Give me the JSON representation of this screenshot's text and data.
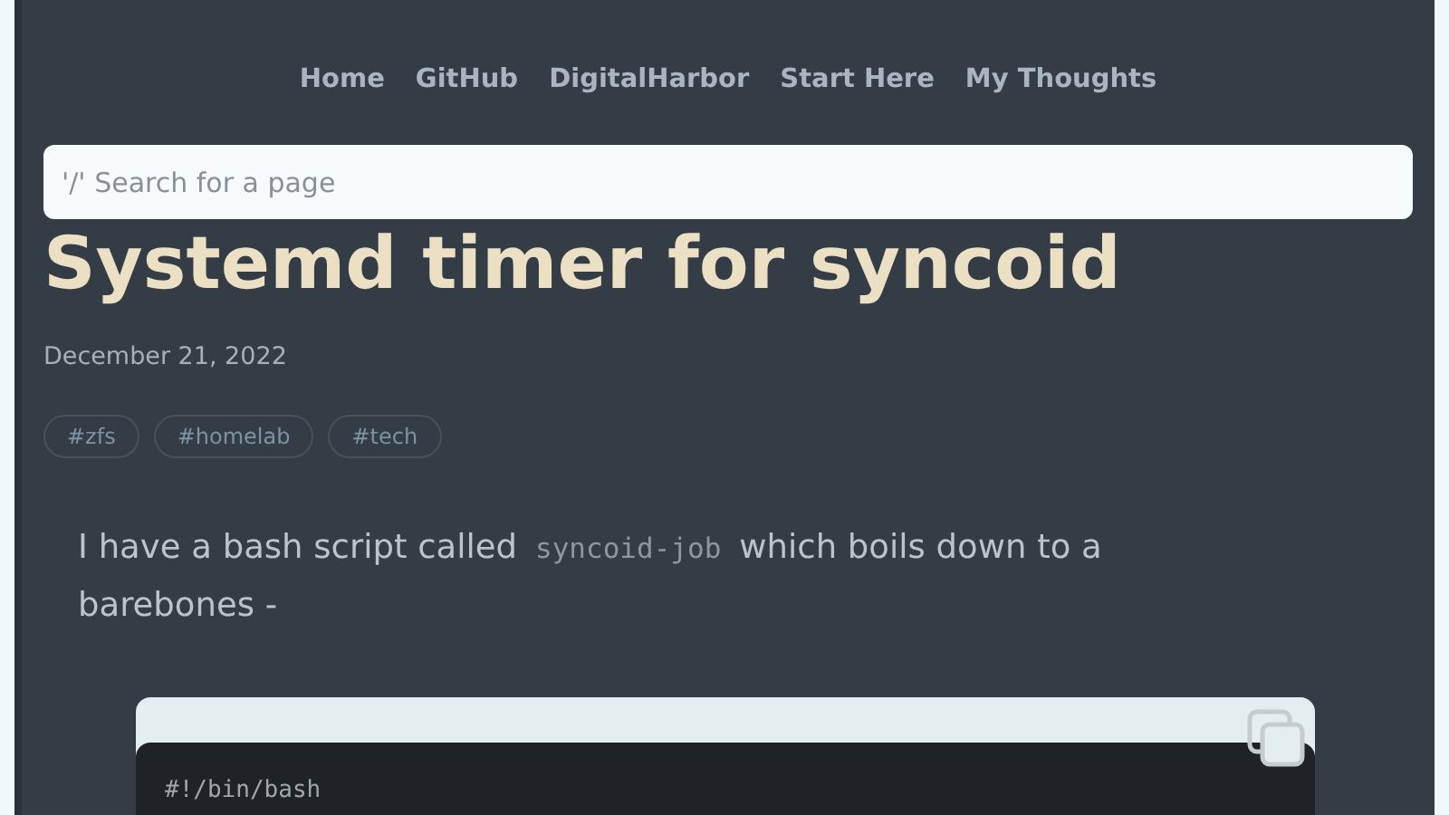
{
  "nav": {
    "links": [
      "Home",
      "GitHub",
      "DigitalHarbor",
      "Start Here",
      "My Thoughts"
    ]
  },
  "search": {
    "placeholder": "'/' Search for a page"
  },
  "article": {
    "title": "Systemd timer for syncoid",
    "date": "December 21, 2022",
    "tags": [
      "#zfs",
      "#homelab",
      "#tech"
    ],
    "paragraph": {
      "before": "I have a bash script called",
      "code": "syncoid-job",
      "after": "which boils down to a barebones -"
    },
    "code_block": {
      "lines": [
        "#!/bin/bash"
      ]
    }
  }
}
